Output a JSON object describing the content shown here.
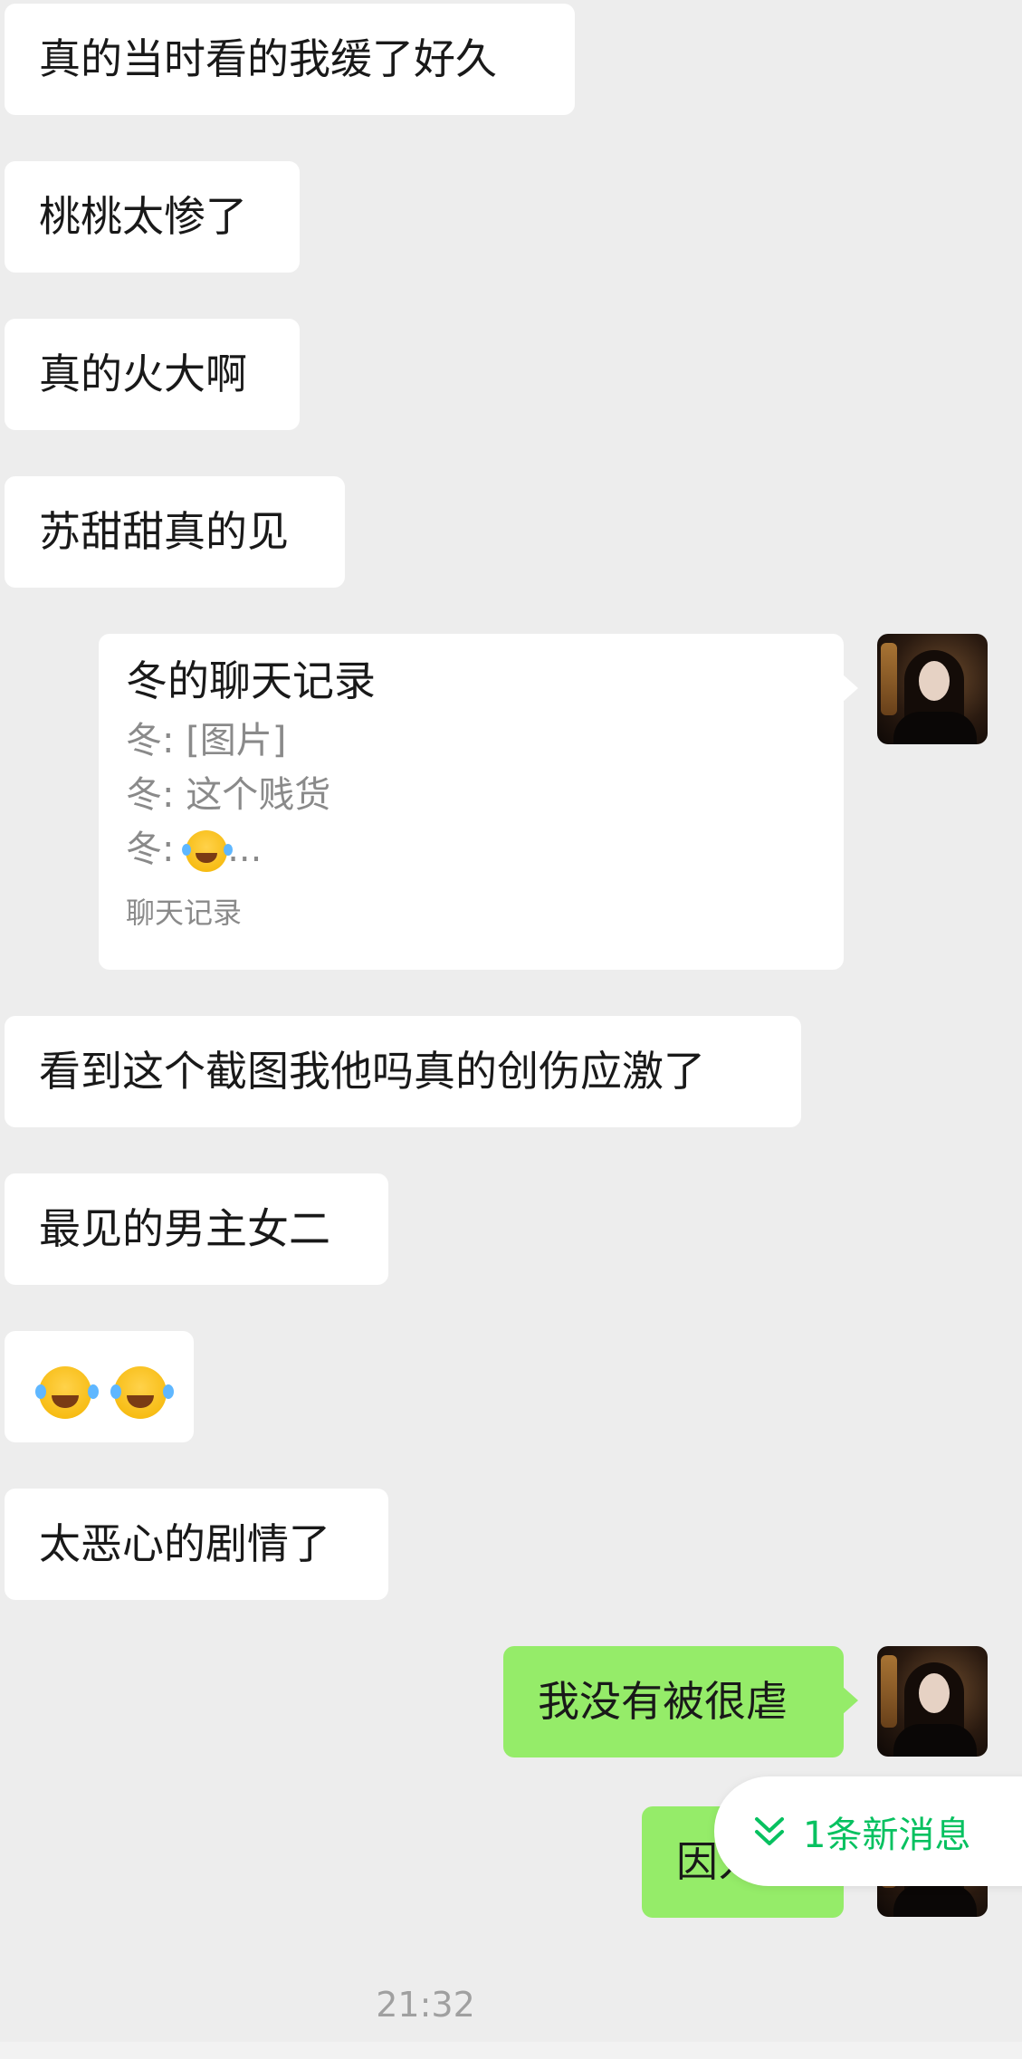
{
  "messages": {
    "m1": "真的当时看的我缓了好久",
    "m2": "桃桃太惨了",
    "m3": "真的火大啊",
    "m4": "苏甜甜真的见",
    "m6": "看到这个截图我他吗真的创伤应激了",
    "m7": "最见的男主女二",
    "m9": "太恶心的剧情了",
    "m10": "我没有被很虐",
    "m11": "因为"
  },
  "card": {
    "title": "冬的聊天记录",
    "line1": "冬: [图片]",
    "line2": "冬: 这个贱货",
    "line3_prefix": "冬: ",
    "line3_suffix": "...",
    "footer": "聊天记录"
  },
  "new_messages": {
    "label": "1条新消息"
  },
  "timestamp": "21:32",
  "icons": {
    "emoji": "face-with-tears-of-joy-icon",
    "chevron": "double-chevron-down-icon"
  },
  "colors": {
    "background": "#ededed",
    "incoming_bubble": "#ffffff",
    "outgoing_bubble": "#95ec69",
    "accent": "#07c160"
  }
}
